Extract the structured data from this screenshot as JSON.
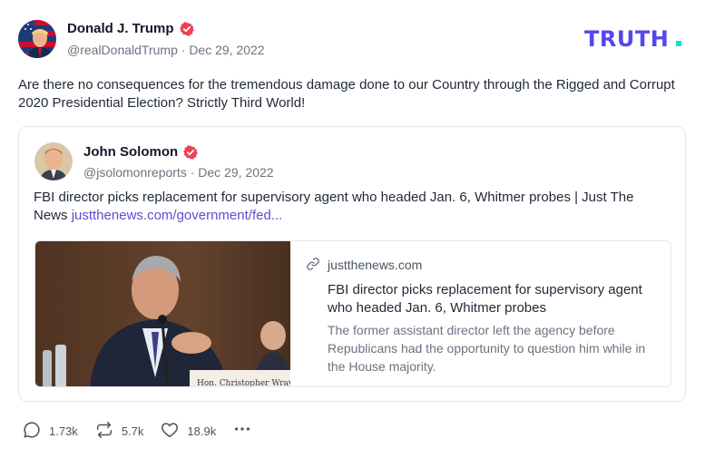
{
  "post": {
    "author": {
      "name": "Donald J. Trump",
      "handle": "@realDonaldTrump",
      "date": "Dec 29, 2022",
      "verified_color": "#ee4056"
    },
    "brand": {
      "logo_text": "TRUTH.",
      "color_primary": "#5448ee",
      "color_accent": "#17e0c8"
    },
    "text": "Are there no consequences for the tremendous damage done to our Country through the Rigged and Corrupt 2020 Presidential Election? Strictly Third World!",
    "quote": {
      "author": {
        "name": "John Solomon",
        "handle": "@jsolomonreports",
        "date": "Dec 29, 2022"
      },
      "text": "FBI director picks replacement for supervisory agent who headed Jan. 6, Whitmer probes | Just The News ",
      "link_text": "justthenews.com/government/fed...",
      "link_color": "#5b4fd1",
      "link_card": {
        "domain": "justthenews.com",
        "title": "FBI director picks replacement for supervisory agent who headed Jan. 6, Whitmer probes",
        "description": "The former assistant director left the agency before Republicans had the opportunity to question him while in the House majority.",
        "image_caption": "Hon. Christopher Wray"
      }
    },
    "actions": {
      "replies": "1.73k",
      "retruths": "5.7k",
      "likes": "18.9k"
    }
  }
}
